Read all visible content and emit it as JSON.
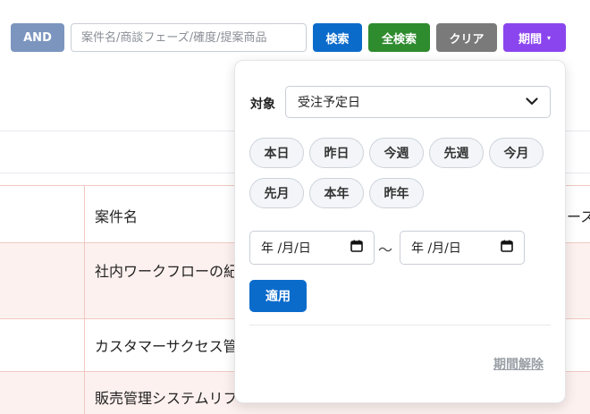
{
  "toolbar": {
    "and_label": "AND",
    "search_placeholder": "案件名/商談フェーズ/確度/提案商品",
    "search_label": "検索",
    "all_search_label": "全検索",
    "clear_label": "クリア",
    "period_label": "期間",
    "period_caret": "▾"
  },
  "table": {
    "header_name": "案件名",
    "header_next_partial": "ース",
    "rows": [
      "社内ワークフローの紀",
      "カスタマーサクセス管",
      "販売管理システムリフ"
    ]
  },
  "period_popover": {
    "target_label": "対象",
    "target_value": "受注予定日",
    "presets": [
      "本日",
      "昨日",
      "今週",
      "先週",
      "今月",
      "先月",
      "本年",
      "昨年"
    ],
    "date_from_placeholder": "年 /月/日",
    "date_to_placeholder": "年 /月/日",
    "range_separator": "〜",
    "apply_label": "適用",
    "clear_period_label": "期間解除"
  },
  "colors": {
    "and": "#7b95bf",
    "search": "#0b6bcb",
    "all_search": "#2e8b2e",
    "clear": "#7a7a7a",
    "period": "#8b45ee",
    "row_band": "#fdf1ef"
  }
}
